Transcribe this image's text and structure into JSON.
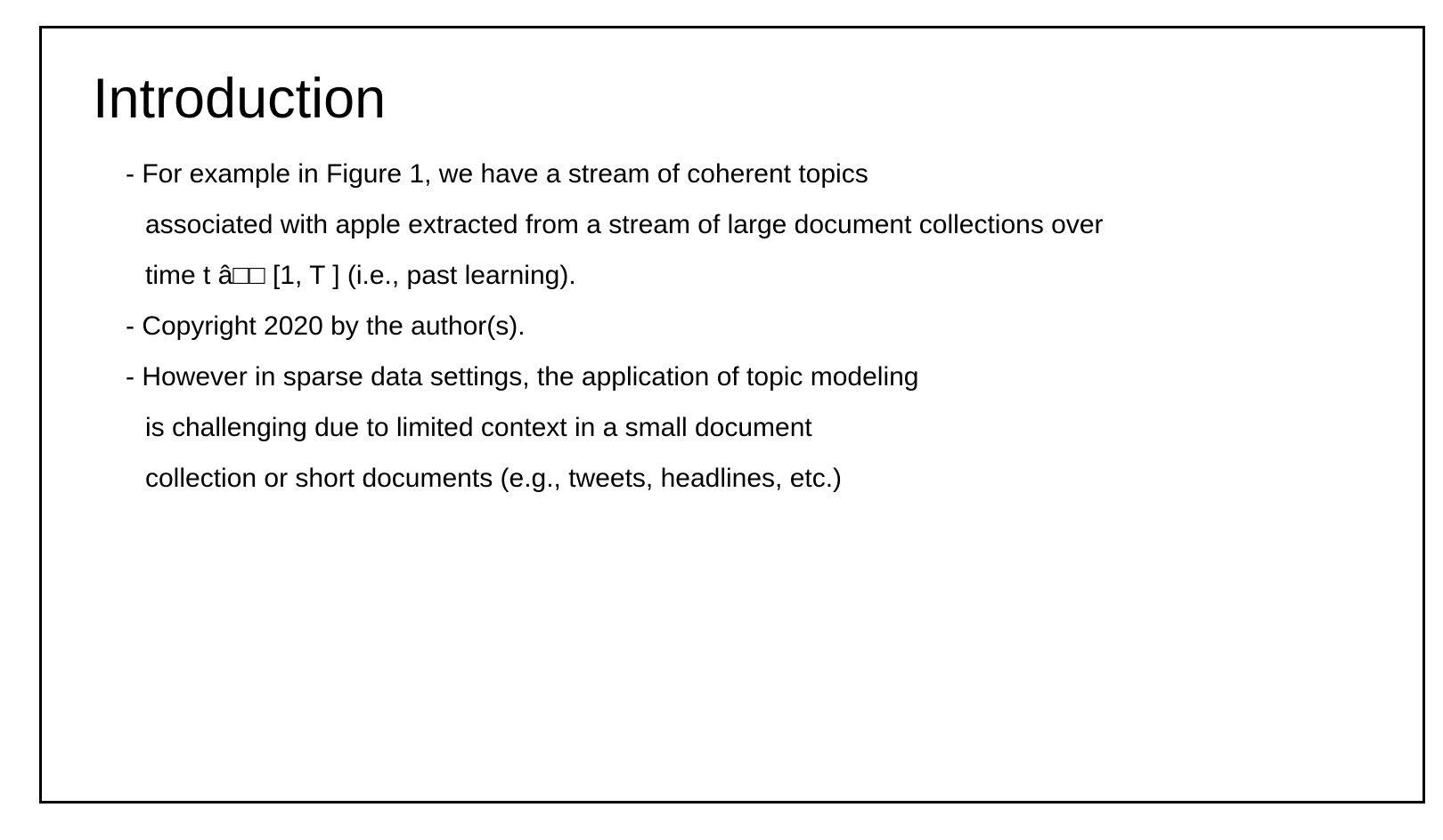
{
  "slide": {
    "title": "Introduction",
    "bullets": [
      {
        "lines": [
          "- For example in Figure 1, we have a stream of coherent topics",
          "associated with apple extracted from a stream of large document collections over",
          "time t â□□ [1, T ] (i.e., past learning)."
        ]
      },
      {
        "lines": [
          "- Copyright 2020 by the author(s)."
        ]
      },
      {
        "lines": [
          "- However in sparse data settings, the application of topic modeling",
          "is challenging due to limited context in a small document",
          "collection or short documents (e.g., tweets, headlines, etc.)"
        ]
      }
    ]
  }
}
